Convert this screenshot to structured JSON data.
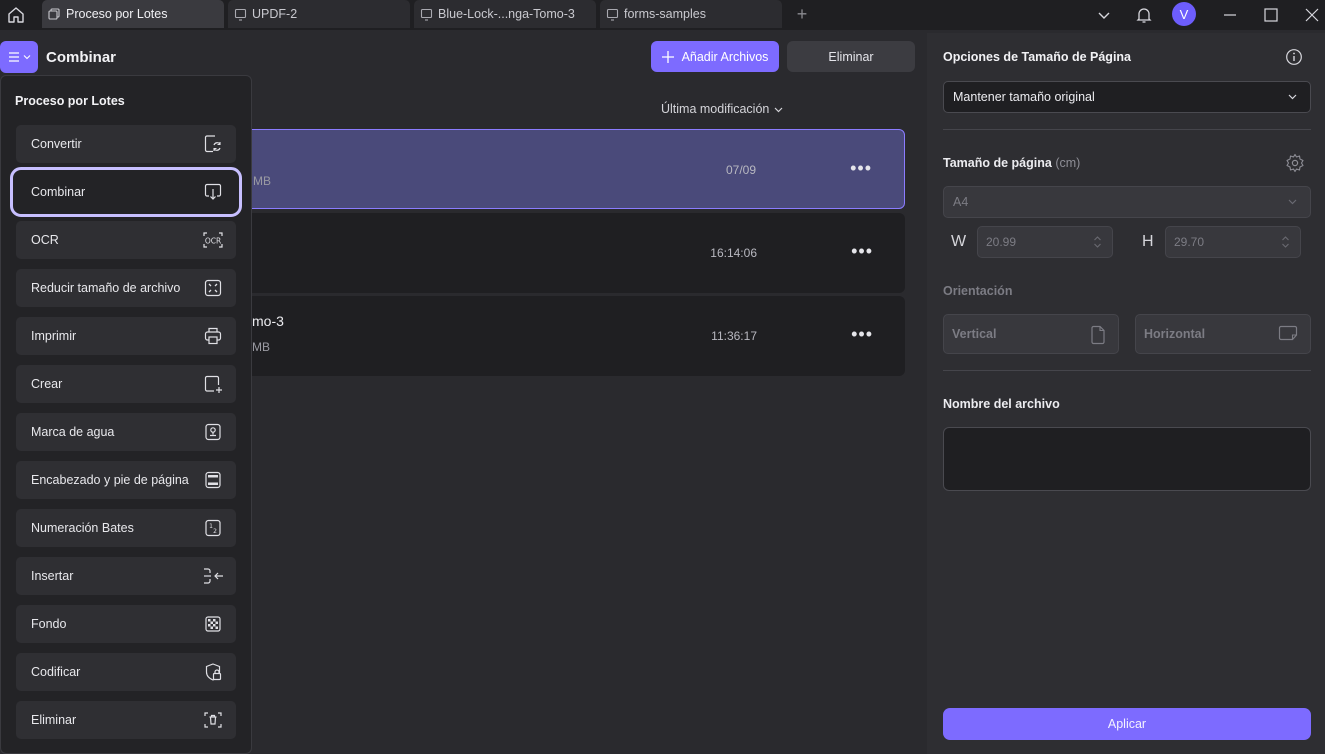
{
  "window": {
    "tabs": [
      {
        "label": "Proceso por Lotes",
        "active": true
      },
      {
        "label": "UPDF-2",
        "active": false
      },
      {
        "label": "Blue-Lock-...nga-Tomo-3",
        "active": false
      },
      {
        "label": "forms-samples",
        "active": false
      }
    ],
    "new_tab": "+",
    "avatar_letter": "V"
  },
  "toolbar": {
    "title": "Combinar",
    "add_files": "Añadir Archivos",
    "delete": "Eliminar"
  },
  "list": {
    "sort_label": "Última modificación",
    "files": [
      {
        "name": "",
        "size": "MB",
        "date": "07/09",
        "more": "•••",
        "selected": true
      },
      {
        "name": "",
        "size": "",
        "date": "16:14:06",
        "more": "•••",
        "selected": false
      },
      {
        "name": "mo-3",
        "size": "MB",
        "date": "11:36:17",
        "more": "•••",
        "selected": false
      }
    ]
  },
  "menu": {
    "title": "Proceso por Lotes",
    "items": [
      {
        "label": "Convertir",
        "icon": "convert-icon"
      },
      {
        "label": "Combinar",
        "icon": "combine-icon"
      },
      {
        "label": "OCR",
        "icon": "ocr-icon"
      },
      {
        "label": "Reducir tamaño de archivo",
        "icon": "compress-icon"
      },
      {
        "label": "Imprimir",
        "icon": "printer-icon"
      },
      {
        "label": "Crear",
        "icon": "create-icon"
      },
      {
        "label": "Marca de agua",
        "icon": "watermark-icon"
      },
      {
        "label": "Encabezado y pie de página",
        "icon": "header-footer-icon"
      },
      {
        "label": "Numeración Bates",
        "icon": "bates-icon"
      },
      {
        "label": "Insertar",
        "icon": "insert-icon"
      },
      {
        "label": "Fondo",
        "icon": "background-icon"
      },
      {
        "label": "Codificar",
        "icon": "encrypt-icon"
      },
      {
        "label": "Eliminar",
        "icon": "delete-icon"
      }
    ]
  },
  "panel": {
    "title": "Opciones de Tamaño de Página",
    "size_option": "Mantener tamaño original",
    "page_size_label": "Tamaño de página",
    "page_size_unit": "(cm)",
    "page_size_value": "A4",
    "width_letter": "W",
    "width_value": "20.99",
    "height_letter": "H",
    "height_value": "29.70",
    "orientation_label": "Orientación",
    "vertical": "Vertical",
    "horizontal": "Horizontal",
    "filename_label": "Nombre del archivo",
    "filename_value": "",
    "apply": "Aplicar"
  },
  "colors": {
    "accent": "#7d6bff",
    "background": "#2a2a2e",
    "panel": "#2e2e32"
  }
}
